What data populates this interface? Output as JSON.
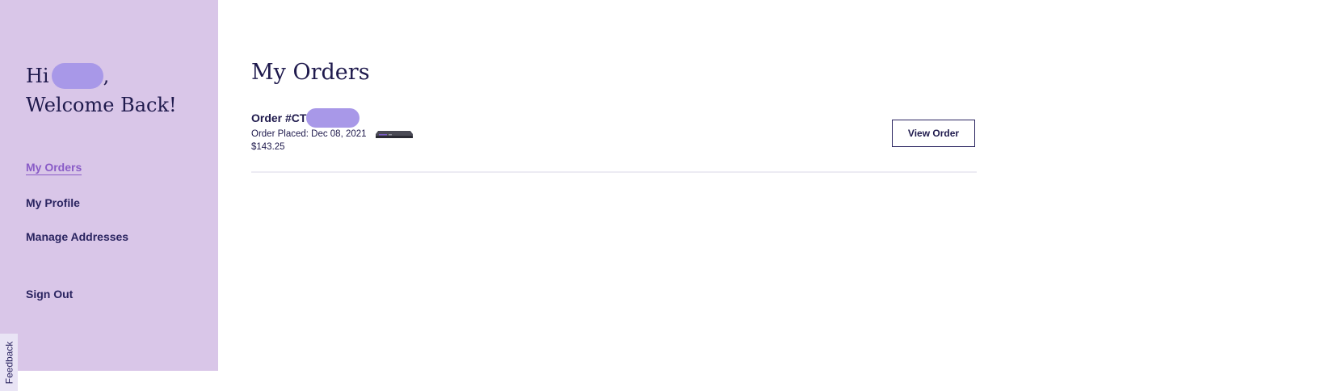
{
  "sidebar": {
    "greeting_hi": "Hi",
    "greeting_comma": ",",
    "greeting_welcome": "Welcome Back!",
    "nav": {
      "my_orders": "My Orders",
      "my_profile": "My Profile",
      "manage_addresses": "Manage Addresses",
      "sign_out": "Sign Out"
    }
  },
  "feedback": {
    "label": "Feedback"
  },
  "main": {
    "title": "My Orders",
    "orders": [
      {
        "number_prefix": "Order #CT",
        "placed": "Order Placed: Dec 08, 2021",
        "total": "$143.25",
        "view_label": "View Order"
      }
    ]
  },
  "colors": {
    "sidebar_bg": "#d9c6e8",
    "redaction": "#a898e8",
    "active_nav": "#8a5cc7",
    "text_dark": "#1f1a4d"
  }
}
